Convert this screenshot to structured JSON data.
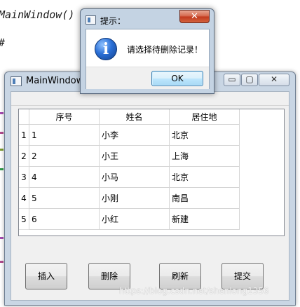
{
  "editor": {
    "lines": [
      "MainWindow()",
      "",
      "#"
    ]
  },
  "main_window": {
    "title": "MainWindow",
    "controls": {
      "minimize": "▭",
      "maximize": "▢",
      "close": "✕"
    }
  },
  "table": {
    "headers": [
      "序号",
      "姓名",
      "居住地"
    ],
    "row_numbers": [
      "1",
      "2",
      "3",
      "4",
      "5"
    ],
    "rows": [
      [
        "1",
        "小李",
        "北京"
      ],
      [
        "2",
        "小王",
        "上海"
      ],
      [
        "4",
        "小马",
        "北京"
      ],
      [
        "5",
        "小刚",
        "南昌"
      ],
      [
        "6",
        "小红",
        "新建"
      ]
    ]
  },
  "buttons": {
    "insert": "插入",
    "delete": "删除",
    "refresh": "刷新",
    "submit": "提交"
  },
  "message_box": {
    "title": "提示：",
    "close": "✕",
    "icon": "i",
    "text": "请选择待删除记录！",
    "ok": "OK"
  },
  "watermark": "https://blog.csdn.net/shenlong1356",
  "colors": {
    "title_bar": "#c9d6e4",
    "close_red": "#c1381c",
    "info_blue": "#2a6fd6"
  }
}
